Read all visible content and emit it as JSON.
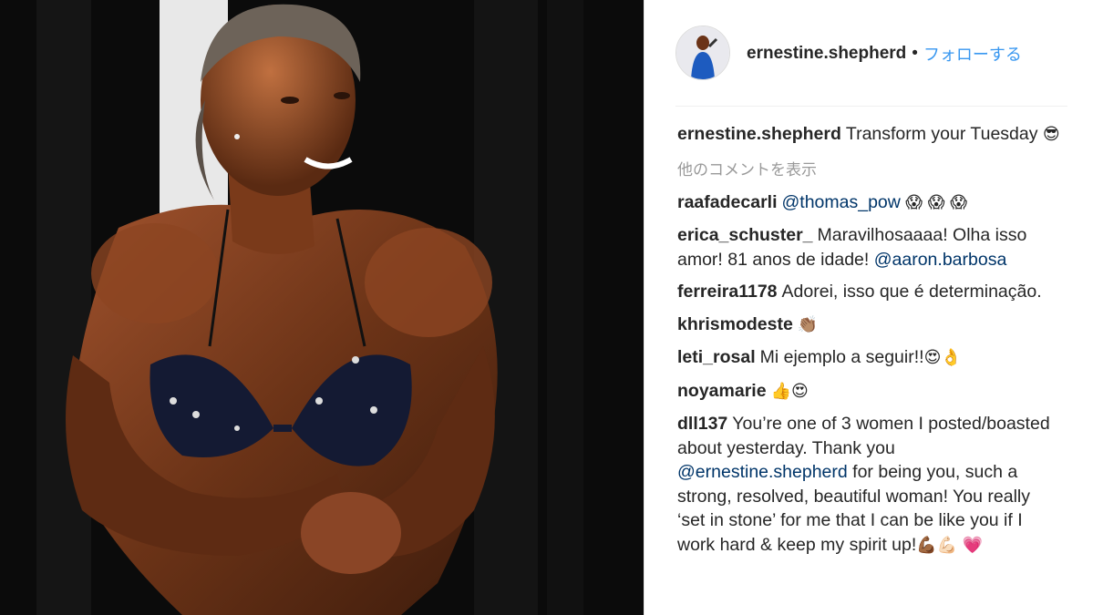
{
  "post": {
    "author": "ernestine.shepherd",
    "dot": "•",
    "follow_label": "フォローする",
    "caption_text": "Transform your Tuesday",
    "caption_emoji": "😎",
    "more_comments_label": "他のコメントを表示"
  },
  "comments": [
    {
      "user": "raafadecarli",
      "mention": "@thomas_pow",
      "emoji": "😱 😱 😱"
    },
    {
      "user": "erica_schuster_",
      "text": "Maravilhosaaaa! Olha isso amor! 81 anos de idade!",
      "mention": "@aaron.barbosa"
    },
    {
      "user": "ferreira1178",
      "text": "Adorei, isso que é determinação."
    },
    {
      "user": "khrismodeste",
      "emoji": "👏🏽"
    },
    {
      "user": "leti_rosal",
      "text": "Mi ejemplo a seguir!!",
      "emoji": "😍👌"
    },
    {
      "user": "noyamarie",
      "emoji": "👍😍"
    },
    {
      "user": "dll137",
      "text_before": "You’re one of 3 women I posted/boasted about yesterday. Thank you",
      "mention": "@ernestine.shepherd",
      "text_after": "for being you, such a strong, resolved, beautiful woman! You really ‘set in stone’ for me that I can be like you if I work hard & keep my spirit up!",
      "emoji": "💪🏾💪🏻",
      "emoji2": "💗"
    }
  ],
  "colors": {
    "link": "#3897f0",
    "mention": "#003569",
    "muted": "#999999",
    "text": "#262626"
  }
}
